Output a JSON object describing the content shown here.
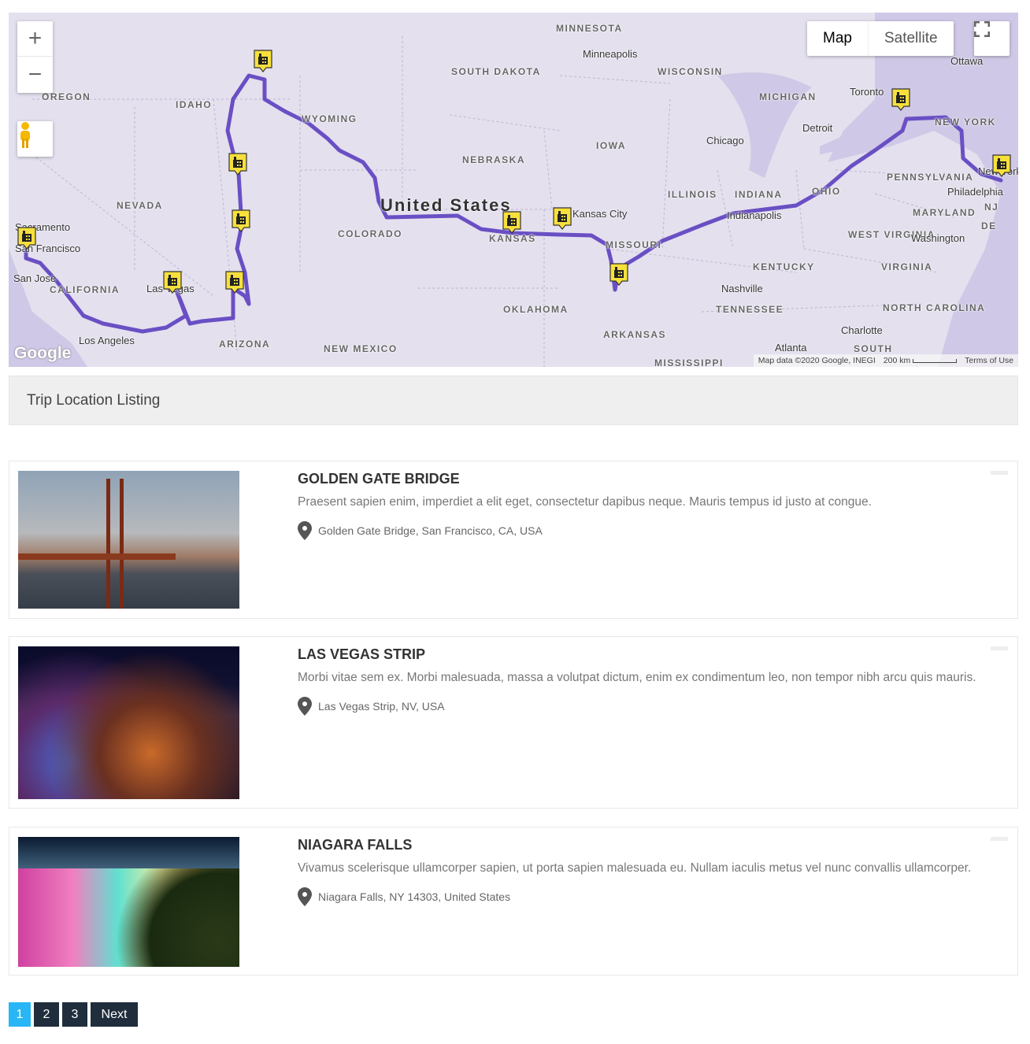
{
  "map": {
    "controls": {
      "zoom_in": "+",
      "zoom_out": "−",
      "map_type": [
        "Map",
        "Satellite"
      ],
      "active_type": "Map"
    },
    "country_label": "United States",
    "state_labels": [
      "OREGON",
      "IDAHO",
      "NEVADA",
      "CALIFORNIA",
      "ARIZONA",
      "NEW MEXICO",
      "COLORADO",
      "WYOMING",
      "SOUTH DAKOTA",
      "MINNESOTA",
      "NEBRASKA",
      "KANSAS",
      "OKLAHOMA",
      "IOWA",
      "MISSOURI",
      "ARKANSAS",
      "ILLINOIS",
      "INDIANA",
      "OHIO",
      "WISCONSIN",
      "MICHIGAN",
      "KENTUCKY",
      "TENNESSEE",
      "MISSISSIPPI",
      "WEST VIRGINIA",
      "VIRGINIA",
      "NORTH CAROLINA",
      "SOUTH",
      "PENNSYLVANIA",
      "NEW YORK",
      "MARYLAND",
      "DE",
      "NJ"
    ],
    "city_labels": [
      "Sacramento",
      "San Francisco",
      "San Jose",
      "Los Angeles",
      "Las Vegas",
      "Minneapolis",
      "Chicago",
      "Detroit",
      "Toronto",
      "Ottawa",
      "Kansas City",
      "Indianapolis",
      "Nashville",
      "Atlanta",
      "Charlotte",
      "Washington",
      "Philadelphia",
      "New York"
    ],
    "route_color": "#6a4fc4",
    "marker_color": "#f7e03c",
    "marker_icon": "hotel-icon",
    "attribution": "Map data ©2020 Google, INEGI",
    "scale": "200 km",
    "terms": "Terms of Use",
    "logo": "Google"
  },
  "listing": {
    "heading": "Trip Location Listing",
    "items": [
      {
        "title": "GOLDEN GATE BRIDGE",
        "description": "Praesent sapien enim, imperdiet a elit eget, consectetur dapibus neque. Mauris tempus id justo at congue.",
        "location": "Golden Gate Bridge, San Francisco, CA, USA"
      },
      {
        "title": "LAS VEGAS STRIP",
        "description": "Morbi vitae sem ex. Morbi malesuada, massa a volutpat dictum, enim ex condimentum leo, non tempor nibh arcu quis mauris.",
        "location": "Las Vegas Strip, NV, USA"
      },
      {
        "title": "NIAGARA FALLS",
        "description": "Vivamus scelerisque ullamcorper sapien, ut porta sapien malesuada eu. Nullam iaculis metus vel nunc convallis ullamcorper.",
        "location": "Niagara Falls, NY 14303, United States"
      }
    ]
  },
  "pagination": {
    "pages": [
      "1",
      "2",
      "3"
    ],
    "current": "1",
    "next": "Next",
    "active_color": "#29b6f6"
  }
}
